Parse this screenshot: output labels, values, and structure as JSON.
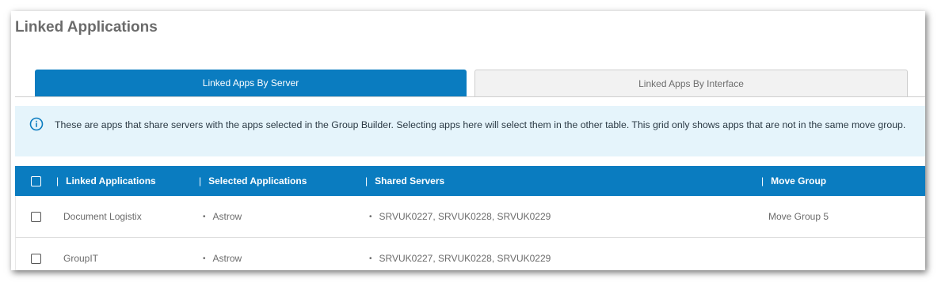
{
  "page": {
    "title": "Linked Applications"
  },
  "tabs": [
    {
      "label": "Linked Apps By Server",
      "active": true
    },
    {
      "label": "Linked Apps By Interface",
      "active": false
    }
  ],
  "info": {
    "text": "These are apps that share servers with the apps selected in the Group Builder. Selecting apps here will select them in the other table. This grid only shows apps that are not in the same move group."
  },
  "table": {
    "separator": "|",
    "columns": [
      "Linked Applications",
      "Selected Applications",
      "Shared Servers",
      "Move Group"
    ],
    "rows": [
      {
        "linked": "Document Logistix",
        "selected": "Astrow",
        "servers": "SRVUK0227, SRVUK0228, SRVUK0229",
        "move_group": "Move Group 5"
      },
      {
        "linked": "GroupIT",
        "selected": "Astrow",
        "servers": "SRVUK0227, SRVUK0228, SRVUK0229",
        "move_group": ""
      }
    ]
  },
  "colors": {
    "primary": "#0a7cc0",
    "info_bg": "#e5f4fb",
    "title": "#6b6b6b"
  }
}
